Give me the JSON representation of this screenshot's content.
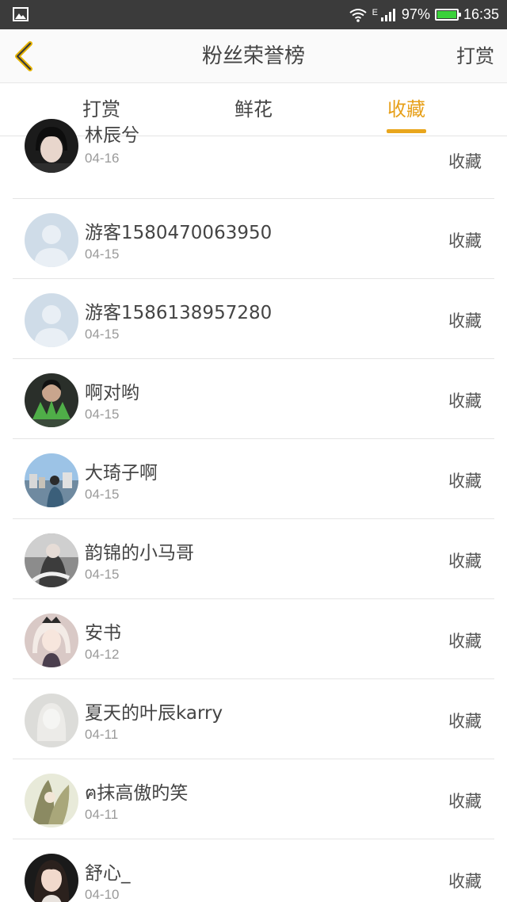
{
  "status_bar": {
    "signal_label": "E",
    "battery": "97%",
    "time": "16:35",
    "icons": [
      "image-icon",
      "wifi-icon",
      "signal-icon",
      "battery-icon"
    ]
  },
  "header": {
    "back_icon": "chevron-left-icon",
    "title": "粉丝荣誉榜",
    "right_action": "打赏"
  },
  "tabs": [
    {
      "label": "打赏",
      "active": false
    },
    {
      "label": "鲜花",
      "active": false
    },
    {
      "label": "收藏",
      "active": true
    }
  ],
  "accent_color": "#e7a01a",
  "list": [
    {
      "name": "林辰兮",
      "date": "04-16",
      "action": "收藏",
      "avatar": "photo-dark-girl"
    },
    {
      "name": "游客1580470063950",
      "date": "04-15",
      "action": "收藏",
      "avatar": "default-user"
    },
    {
      "name": "游客1586138957280",
      "date": "04-15",
      "action": "收藏",
      "avatar": "default-user"
    },
    {
      "name": "啊对哟",
      "date": "04-15",
      "action": "收藏",
      "avatar": "photo-green"
    },
    {
      "name": "大琦子啊",
      "date": "04-15",
      "action": "收藏",
      "avatar": "photo-city"
    },
    {
      "name": "韵锦的小马哥",
      "date": "04-15",
      "action": "收藏",
      "avatar": "photo-mono"
    },
    {
      "name": "安书",
      "date": "04-12",
      "action": "收藏",
      "avatar": "photo-anime"
    },
    {
      "name": "夏天的叶辰karry",
      "date": "04-11",
      "action": "收藏",
      "avatar": "default-gray"
    },
    {
      "name": "ฅ抹高傲旳笑",
      "date": "04-11",
      "action": "收藏",
      "avatar": "photo-olive"
    },
    {
      "name": "舒心_",
      "date": "04-10",
      "action": "收藏",
      "avatar": "photo-portrait"
    }
  ]
}
